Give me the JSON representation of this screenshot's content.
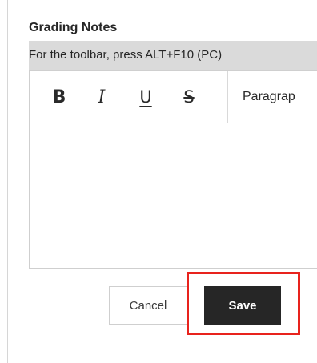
{
  "section": {
    "title": "Grading Notes",
    "hint": "For the toolbar, press ALT+F10 (PC)"
  },
  "toolbar": {
    "bold_label": "B",
    "italic_label": "I",
    "underline_label": "U",
    "strike_label": "S",
    "paragraph_label": "Paragrap"
  },
  "editor": {
    "content": ""
  },
  "actions": {
    "cancel_label": "Cancel",
    "save_label": "Save"
  },
  "annotation": {
    "highlight_color": "#e8231d"
  }
}
